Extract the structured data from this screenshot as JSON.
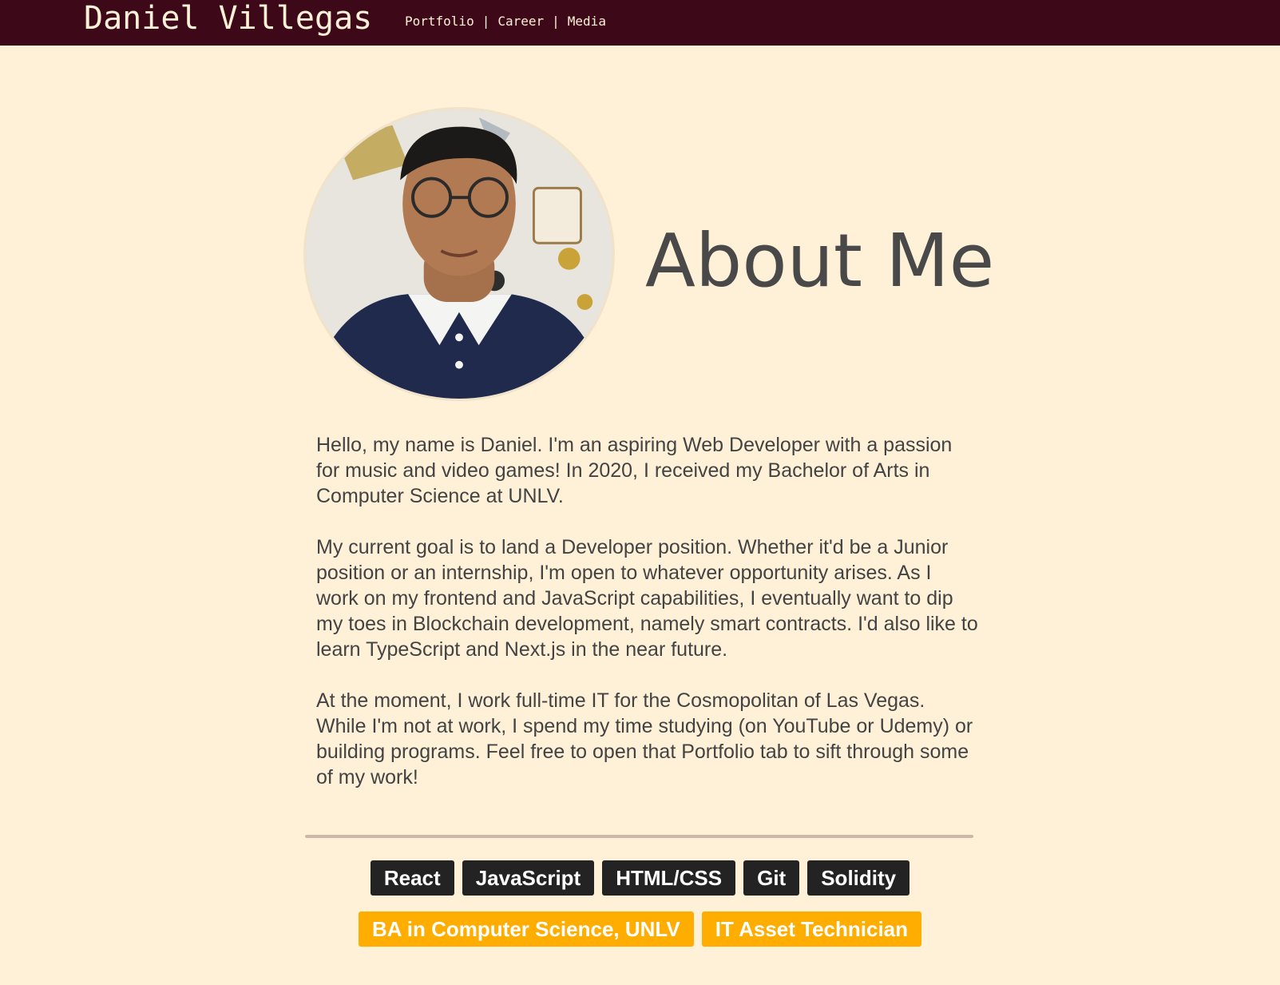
{
  "header": {
    "brand": "Daniel Villegas",
    "nav": [
      {
        "label": "Portfolio"
      },
      {
        "label": "Career"
      },
      {
        "label": "Media"
      }
    ],
    "separator": "|",
    "bg_color": "#3d0918",
    "text_color": "#fff1d8"
  },
  "main": {
    "title": "About Me",
    "avatar_icon": "profile-photo",
    "paragraphs": [
      "Hello, my name is Daniel. I'm an aspiring Web Developer with a passion for music and video games! In 2020, I received my Bachelor of Arts in Computer Science at UNLV.",
      "My current goal is to land a Developer position. Whether it'd be a Junior position or an internship, I'm open to whatever opportunity arises. As I work on my frontend and JavaScript capabilities, I eventually want to dip my toes in Blockchain development, namely smart contracts. I'd also like to learn TypeScript and Next.js in the near future.",
      "At the moment, I work full-time IT for the Cosmopolitan of Las Vegas. While I'm not at work, I spend my time studying (on YouTube or Udemy) or building programs. Feel free to open that Portfolio tab to sift through some of my work!"
    ],
    "skills": [
      "React",
      "JavaScript",
      "HTML/CSS",
      "Git",
      "Solidity"
    ],
    "credentials": [
      "BA in Computer Science, UNLV",
      "IT Asset Technician"
    ],
    "colors": {
      "background": "#fff1d8",
      "skill_tag": "#232323",
      "credential_tag": "#ffad00",
      "divider": "#cdb8a7"
    }
  }
}
